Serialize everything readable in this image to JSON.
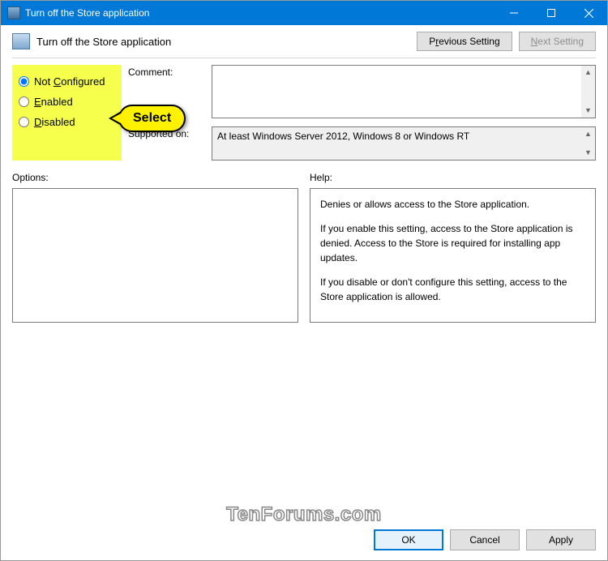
{
  "window": {
    "title": "Turn off the Store application"
  },
  "header": {
    "policy_title": "Turn off the Store application",
    "prev_button_pre": "P",
    "prev_button_u": "r",
    "prev_button_post": "evious Setting",
    "next_button_pre": "",
    "next_button_u": "N",
    "next_button_post": "ext Setting"
  },
  "radios": {
    "not_configured_pre": "Not ",
    "not_configured_u": "C",
    "not_configured_post": "onfigured",
    "enabled_u": "E",
    "enabled_post": "nabled",
    "disabled_u": "D",
    "disabled_post": "isabled",
    "selected": "not_configured"
  },
  "annotation": {
    "select_label": "Select"
  },
  "fields": {
    "comment_label": "Comment:",
    "comment_value": "",
    "supported_label": "Supported on:",
    "supported_value": "At least Windows Server 2012, Windows 8 or Windows RT"
  },
  "options": {
    "label": "Options:",
    "content": ""
  },
  "help": {
    "label": "Help:",
    "p1": "Denies or allows access to the Store application.",
    "p2": "If you enable this setting, access to the Store application is denied. Access to the Store is required for installing app updates.",
    "p3": "If you disable or don't configure this setting, access to the Store application is allowed."
  },
  "footer": {
    "ok": "OK",
    "cancel": "Cancel",
    "apply": "Apply"
  },
  "watermark": "TenForums.com"
}
